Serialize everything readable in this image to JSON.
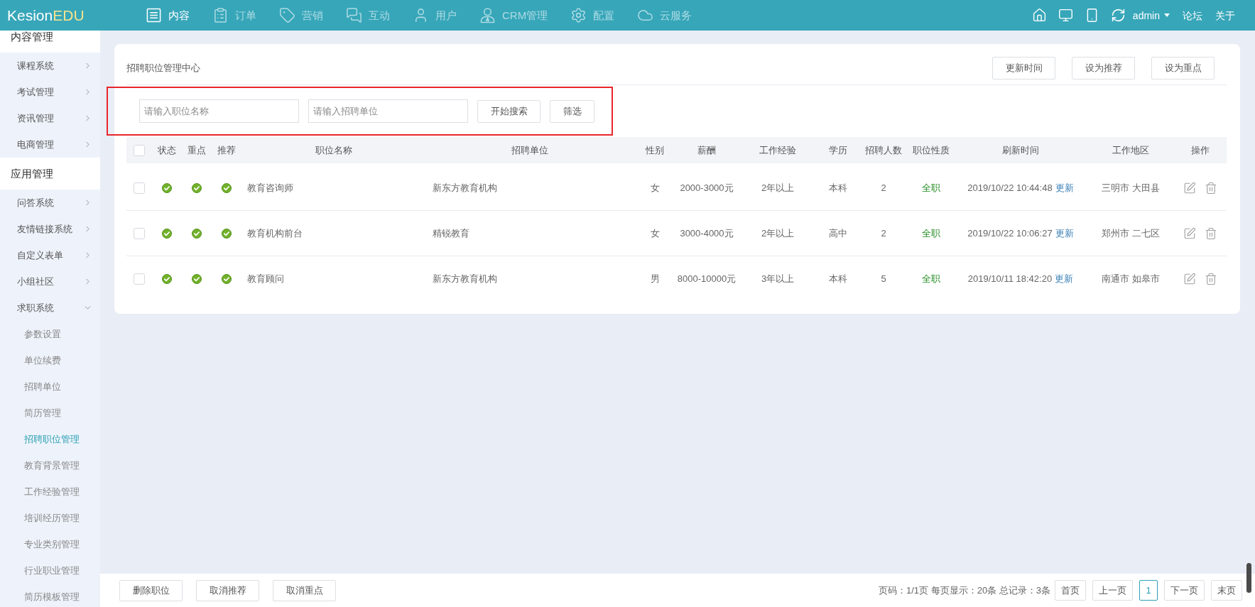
{
  "header": {
    "logo": {
      "brand": "Kesion",
      "suffix": "EDU"
    },
    "nav": [
      {
        "label": "内容",
        "selected": true
      },
      {
        "label": "订单",
        "selected": false
      },
      {
        "label": "营销",
        "selected": false
      },
      {
        "label": "互动",
        "selected": false
      },
      {
        "label": "用户",
        "selected": false
      },
      {
        "label": "CRM管理",
        "selected": false
      },
      {
        "label": "配置",
        "selected": false
      },
      {
        "label": "云服务",
        "selected": false
      }
    ],
    "user": "admin",
    "links": [
      "论坛",
      "关于"
    ]
  },
  "sidebar": {
    "sections": [
      {
        "title": "内容管理",
        "items": [
          {
            "label": "课程系统",
            "expanded": false
          },
          {
            "label": "考试管理",
            "expanded": false
          },
          {
            "label": "资讯管理",
            "expanded": false
          },
          {
            "label": "电商管理",
            "expanded": false
          }
        ]
      },
      {
        "title": "应用管理",
        "items": [
          {
            "label": "问答系统",
            "expanded": false
          },
          {
            "label": "友情链接系统",
            "expanded": false
          },
          {
            "label": "自定义表单",
            "expanded": false
          },
          {
            "label": "小组社区",
            "expanded": false
          },
          {
            "label": "求职系统",
            "expanded": true,
            "children": [
              {
                "label": "参数设置",
                "selected": false
              },
              {
                "label": "单位续费",
                "selected": false
              },
              {
                "label": "招聘单位",
                "selected": false
              },
              {
                "label": "简历管理",
                "selected": false
              },
              {
                "label": "招聘职位管理",
                "selected": true
              },
              {
                "label": "教育背景管理",
                "selected": false
              },
              {
                "label": "工作经验管理",
                "selected": false
              },
              {
                "label": "培训经历管理",
                "selected": false
              },
              {
                "label": "专业类别管理",
                "selected": false
              },
              {
                "label": "行业职业管理",
                "selected": false
              },
              {
                "label": "简历模板管理",
                "selected": false
              }
            ]
          }
        ]
      }
    ]
  },
  "panel": {
    "title": "招聘职位管理中心",
    "actions": [
      "更新时间",
      "设为推荐",
      "设为重点"
    ],
    "search": {
      "highlighted": true,
      "fields": [
        {
          "placeholder": "请输入职位名称"
        },
        {
          "placeholder": "请输入招聘单位"
        }
      ],
      "buttons": [
        "开始搜索",
        "筛选"
      ]
    }
  },
  "table": {
    "select_all": {
      "checked": false
    },
    "columns": [
      "状态",
      "重点",
      "推荐",
      "职位名称",
      "招聘单位",
      "性别",
      "薪酬",
      "工作经验",
      "学历",
      "招聘人数",
      "职位性质",
      "刷新时间",
      "工作地区",
      "操作"
    ],
    "rows": [
      {
        "checked": false,
        "status": true,
        "featured": true,
        "recommended": true,
        "title": "教育咨询师",
        "company": "新东方教育机构",
        "gender": "女",
        "salary": "2000-3000元",
        "experience": "2年以上",
        "education": "本科",
        "headcount": "2",
        "type": "全职",
        "refreshed": "2019/10/22 10:44:48",
        "refresh_link": "更新",
        "region": "三明市 大田县"
      },
      {
        "checked": false,
        "status": true,
        "featured": true,
        "recommended": true,
        "title": "教育机构前台",
        "company": "精锐教育",
        "gender": "女",
        "salary": "3000-4000元",
        "experience": "2年以上",
        "education": "高中",
        "headcount": "2",
        "type": "全职",
        "refreshed": "2019/10/22 10:06:27",
        "refresh_link": "更新",
        "region": "郑州市 二七区"
      },
      {
        "checked": false,
        "status": true,
        "featured": true,
        "recommended": true,
        "title": "教育顾问",
        "company": "新东方教育机构",
        "gender": "男",
        "salary": "8000-10000元",
        "experience": "3年以上",
        "education": "本科",
        "headcount": "5",
        "type": "全职",
        "refreshed": "2019/10/11 18:42:20",
        "refresh_link": "更新",
        "region": "南通市 如皋市"
      }
    ]
  },
  "footer": {
    "actions": [
      "删除职位",
      "取消推荐",
      "取消重点"
    ],
    "summary": "页码：1/1页 每页显示：20条 总记录：3条",
    "pages": [
      {
        "label": "首页",
        "selected": false
      },
      {
        "label": "上一页",
        "selected": false
      },
      {
        "label": "1",
        "selected": true
      },
      {
        "label": "下一页",
        "selected": false
      },
      {
        "label": "末页",
        "selected": false
      }
    ]
  }
}
